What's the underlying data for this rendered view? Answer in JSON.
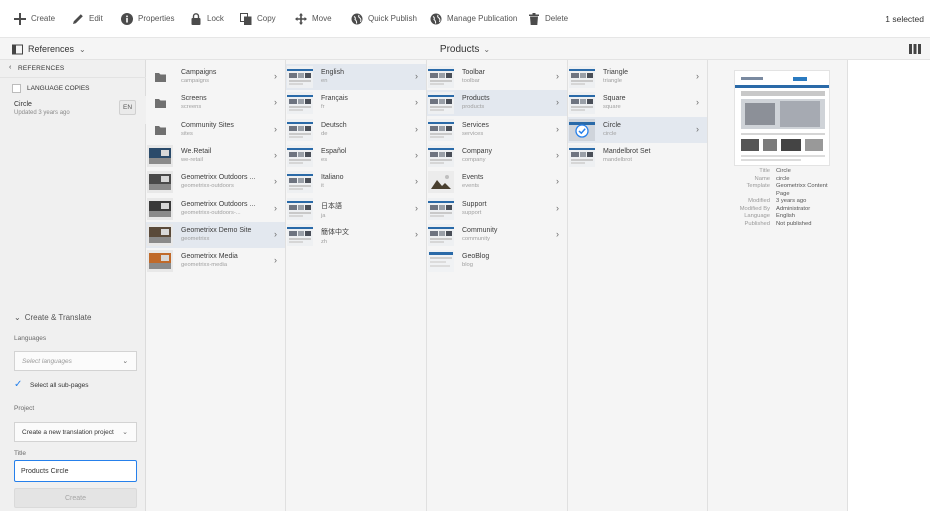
{
  "toolbar": {
    "create": "Create",
    "edit": "Edit",
    "properties": "Properties",
    "lock": "Lock",
    "copy": "Copy",
    "move": "Move",
    "quick_publish": "Quick Publish",
    "manage_publication": "Manage Publication",
    "delete": "Delete",
    "selected": "1 selected"
  },
  "subbar": {
    "rail_label": "References",
    "page_title": "Products"
  },
  "rail": {
    "back_label": "REFERENCES",
    "language_copies": "LANGUAGE COPIES",
    "current_name": "Circle",
    "current_updated": "Updated 3 years ago",
    "current_lang": "EN",
    "create_translate": "Create & Translate",
    "languages_label": "Languages",
    "languages_placeholder": "Select languages",
    "select_all_subpages": "Select all sub-pages",
    "project_label": "Project",
    "project_value": "Create a new translation project",
    "title_label": "Title",
    "title_value": "Products Circle",
    "create_button": "Create"
  },
  "columns": {
    "sites": [
      {
        "title": "Campaigns",
        "name": "campaigns"
      },
      {
        "title": "Screens",
        "name": "screens"
      },
      {
        "title": "Community Sites",
        "name": "sites"
      },
      {
        "title": "We.Retail",
        "name": "we-retail"
      },
      {
        "title": "Geometrixx Outdoors ...",
        "name": "geometrixx-outdoors"
      },
      {
        "title": "Geometrixx Outdoors ...",
        "name": "geometrixx-outdoors-..."
      },
      {
        "title": "Geometrixx Demo Site",
        "name": "geometrixx"
      },
      {
        "title": "Geometrixx Media",
        "name": "geometrixx-media"
      }
    ],
    "languages": [
      {
        "title": "English",
        "name": "en"
      },
      {
        "title": "Français",
        "name": "fr"
      },
      {
        "title": "Deutsch",
        "name": "de"
      },
      {
        "title": "Español",
        "name": "es"
      },
      {
        "title": "Italiano",
        "name": "it"
      },
      {
        "title": "日本語",
        "name": "ja"
      },
      {
        "title": "簡体中文",
        "name": "zh"
      }
    ],
    "english": [
      {
        "title": "Toolbar",
        "name": "toolbar"
      },
      {
        "title": "Products",
        "name": "products"
      },
      {
        "title": "Services",
        "name": "services"
      },
      {
        "title": "Company",
        "name": "company"
      },
      {
        "title": "Events",
        "name": "events"
      },
      {
        "title": "Support",
        "name": "support"
      },
      {
        "title": "Community",
        "name": "community"
      },
      {
        "title": "GeoBlog",
        "name": "blog"
      }
    ],
    "products": [
      {
        "title": "Triangle",
        "name": "triangle"
      },
      {
        "title": "Square",
        "name": "square"
      },
      {
        "title": "Circle",
        "name": "circle"
      },
      {
        "title": "Mandelbrot Set",
        "name": "mandelbrot"
      }
    ]
  },
  "preview": {
    "meta": [
      {
        "key": "Title",
        "value": "Circle"
      },
      {
        "key": "Name",
        "value": "circle"
      },
      {
        "key": "Template",
        "value": "Geometrixx Content Page"
      },
      {
        "key": "Modified",
        "value": "3 years ago"
      },
      {
        "key": "Modified By",
        "value": "Administrator"
      },
      {
        "key": "Language",
        "value": "English"
      },
      {
        "key": "Published",
        "value": "Not published"
      }
    ]
  },
  "colors": {
    "accent": "#2680eb",
    "selected_row": "#e3e8ef",
    "column_bg": "#f5f5f5"
  }
}
